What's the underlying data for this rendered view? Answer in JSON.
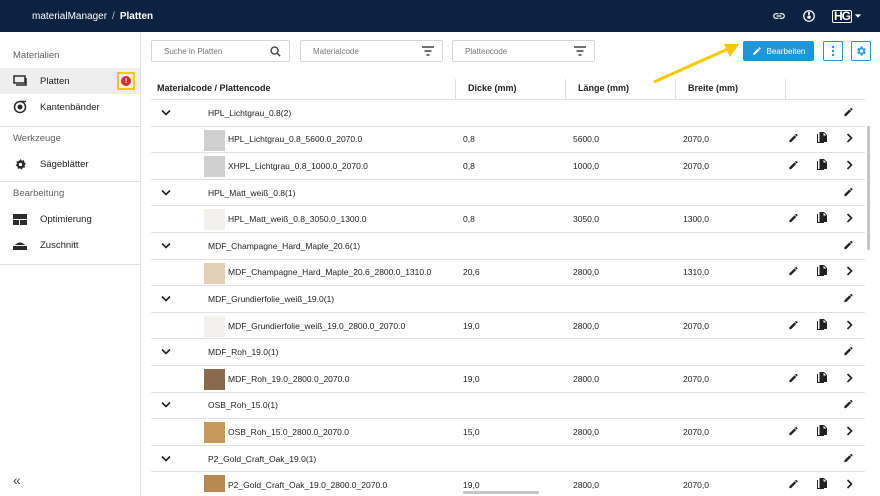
{
  "header": {
    "app_name": "materialManager",
    "separator": "/",
    "current_page": "Platten",
    "logo_text": "HG"
  },
  "sidebar": {
    "sections": [
      {
        "title": "Materialien",
        "items": [
          {
            "label": "Platten",
            "icon": "board-icon",
            "active": true,
            "alert": "!"
          },
          {
            "label": "Kantenbänder",
            "icon": "edge-band-icon"
          }
        ]
      },
      {
        "title": "Werkzeuge",
        "items": [
          {
            "label": "Sägeblätter",
            "icon": "saw-blade-icon"
          }
        ]
      },
      {
        "title": "Bearbeitung",
        "items": [
          {
            "label": "Optimierung",
            "icon": "optimization-icon"
          },
          {
            "label": "Zuschnitt",
            "icon": "cut-icon"
          }
        ]
      }
    ],
    "collapse_glyph": "«"
  },
  "toolbar": {
    "search_placeholder": "Suche in Platten",
    "filter_material": "Materialcode",
    "filter_board": "Plattencode",
    "edit_label": "Bearbeiten"
  },
  "table": {
    "headers": {
      "code": "Materialcode / Plattencode",
      "thickness": "Dicke (mm)",
      "length": "Länge (mm)",
      "width": "Breite (mm)"
    },
    "rows": [
      {
        "type": "group",
        "name": "HPL_Lichtgrau_0.8",
        "count": "(2)"
      },
      {
        "type": "child",
        "name": "HPL_Lichtgrau_0.8_5600.0_2070.0",
        "d": "0,8",
        "l": "5600,0",
        "b": "2070,0",
        "color": "#cfcfcf"
      },
      {
        "type": "child",
        "name": "XHPL_Lichtgrau_0.8_1000.0_2070.0",
        "d": "0,8",
        "l": "1000,0",
        "b": "2070,0",
        "color": "#cfcfcf"
      },
      {
        "type": "group",
        "name": "HPL_Matt_weiß_0.8",
        "count": "(1)"
      },
      {
        "type": "child",
        "name": "HPL_Matt_weiß_0.8_3050.0_1300.0",
        "d": "0,8",
        "l": "3050,0",
        "b": "1300,0",
        "color": "#f1f0ed"
      },
      {
        "type": "group",
        "name": "MDF_Champagne_Hard_Maple_20.6",
        "count": "(1)"
      },
      {
        "type": "child",
        "name": "MDF_Champagne_Hard_Maple_20.6_2800.0_1310.0",
        "d": "20,6",
        "l": "2800,0",
        "b": "1310,0",
        "color": "#e4d0b5"
      },
      {
        "type": "group",
        "name": "MDF_Grundierfolie_weiß_19.0",
        "count": "(1)"
      },
      {
        "type": "child",
        "name": "MDF_Grundierfolie_weiß_19.0_2800.0_2070.0",
        "d": "19,0",
        "l": "2800,0",
        "b": "2070,0",
        "color": "#f1f0ed"
      },
      {
        "type": "group",
        "name": "MDF_Roh_19.0",
        "count": "(1)"
      },
      {
        "type": "child",
        "name": "MDF_Roh_19.0_2800.0_2070.0",
        "d": "19,0",
        "l": "2800,0",
        "b": "2070,0",
        "color": "#8a6a4c"
      },
      {
        "type": "group",
        "name": "OSB_Roh_15.0",
        "count": "(1)"
      },
      {
        "type": "child",
        "name": "OSB_Roh_15.0_2800.0_2070.0",
        "d": "15,0",
        "l": "2800,0",
        "b": "2070,0",
        "color": "#c79a5c"
      },
      {
        "type": "group",
        "name": "P2_Gold_Craft_Oak_19.0",
        "count": "(1)"
      },
      {
        "type": "child",
        "name": "P2_Gold_Craft_Oak_19.0_2800.0_2070.0",
        "d": "19,0",
        "l": "2800,0",
        "b": "2070,0",
        "color": "#b88a52"
      }
    ]
  },
  "colors": {
    "header_bg": "#0c2240",
    "accent": "#1e96d9",
    "highlight": "#f7c800",
    "alert": "#d32f2f"
  }
}
